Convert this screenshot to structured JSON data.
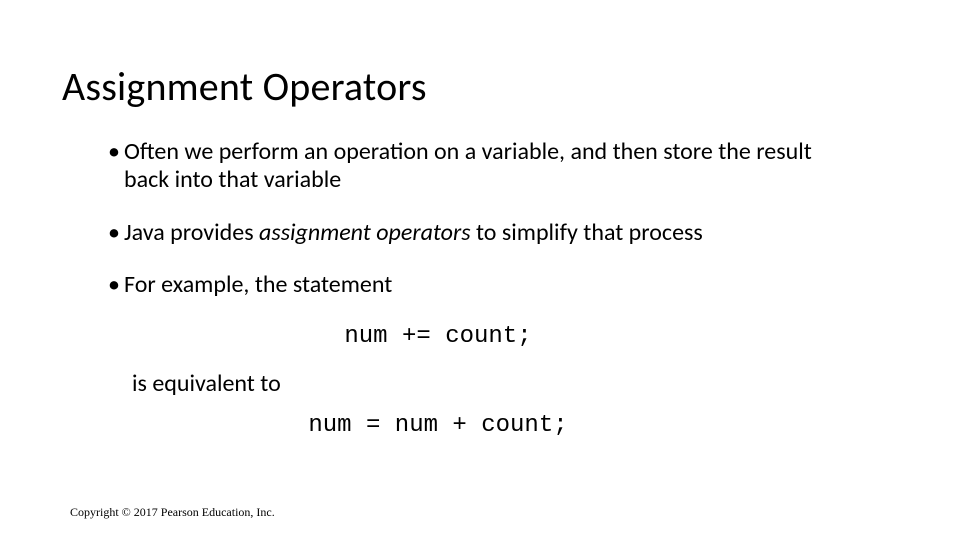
{
  "title": "Assignment Operators",
  "bullets": {
    "b1": "Often we perform an operation on a variable, and then store the result back into that variable",
    "b2_pre": "Java provides ",
    "b2_em": "assignment operators",
    "b2_post": " to simplify that process",
    "b3": "For example, the statement"
  },
  "code1": "num += count;",
  "followup": "is equivalent to",
  "code2": "num = num + count;",
  "copyright": "Copyright © 2017 Pearson Education, Inc."
}
